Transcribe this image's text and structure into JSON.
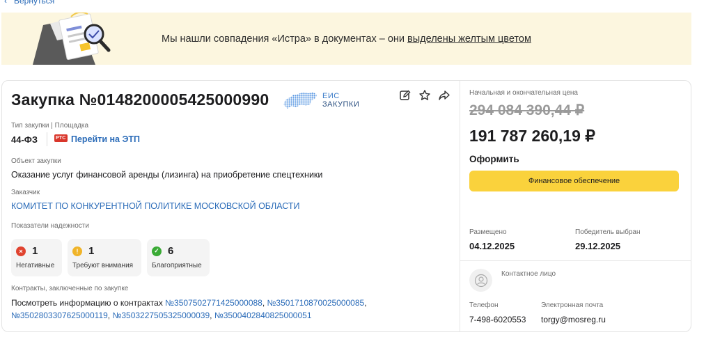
{
  "nav": {
    "back_label": "Вернуться"
  },
  "banner": {
    "text_before": "Мы нашли совпадения «Истра» в документах – они ",
    "text_link": "выделены желтым цветом"
  },
  "purchase": {
    "title": "Закупка №0148200005425000990",
    "eis_line1": "ЕИС",
    "eis_line2": "ЗАКУПКИ",
    "type_label": "Тип закупки | Площадка",
    "type_value": "44-ФЗ",
    "platform_badge": "РТС",
    "platform_link": "Перейти на ЭТП",
    "object_label": "Объект закупки",
    "object_value": "Оказание услуг финансовой аренды (лизинга) на приобретение спецтехники",
    "customer_label": "Заказчик",
    "customer_value": "КОМИТЕТ ПО КОНКУРЕНТНОЙ ПОЛИТИКЕ МОСКОВСКОЙ ОБЛАСТИ",
    "reliability_label": "Показатели надежности",
    "reliability": [
      {
        "count": "1",
        "caption": "Негативные",
        "color": "#e0432f",
        "glyph": "×"
      },
      {
        "count": "1",
        "caption": "Требуют внимания",
        "color": "#f0b429",
        "glyph": "!"
      },
      {
        "count": "6",
        "caption": "Благоприятные",
        "color": "#3aaa35",
        "glyph": "✓"
      }
    ],
    "contracts_label": "Контракты, заключенные по закупке",
    "contracts_prefix": "Посмотреть информацию о контрактах ",
    "contracts": [
      "№3507502771425000088",
      "№3501710870025000085",
      "№3502803307625000119",
      "№3503227505325000039",
      "№3500402840825000051"
    ]
  },
  "pricing": {
    "label": "Начальная и окончательная цена",
    "initial_price": "294 084 390,44 ₽",
    "final_price": "191 787 260,19 ₽",
    "issue_label": "Оформить",
    "finance_button": "Финансовое обеспечение",
    "posted_label": "Размещено",
    "posted_date": "04.12.2025",
    "winner_label": "Победитель выбран",
    "winner_date": "29.12.2025"
  },
  "contact": {
    "label": "Контактное лицо",
    "phone_label": "Телефон",
    "phone": "7-498-6020553",
    "email_label": "Электронная почта",
    "email": "torgy@mosreg.ru"
  }
}
